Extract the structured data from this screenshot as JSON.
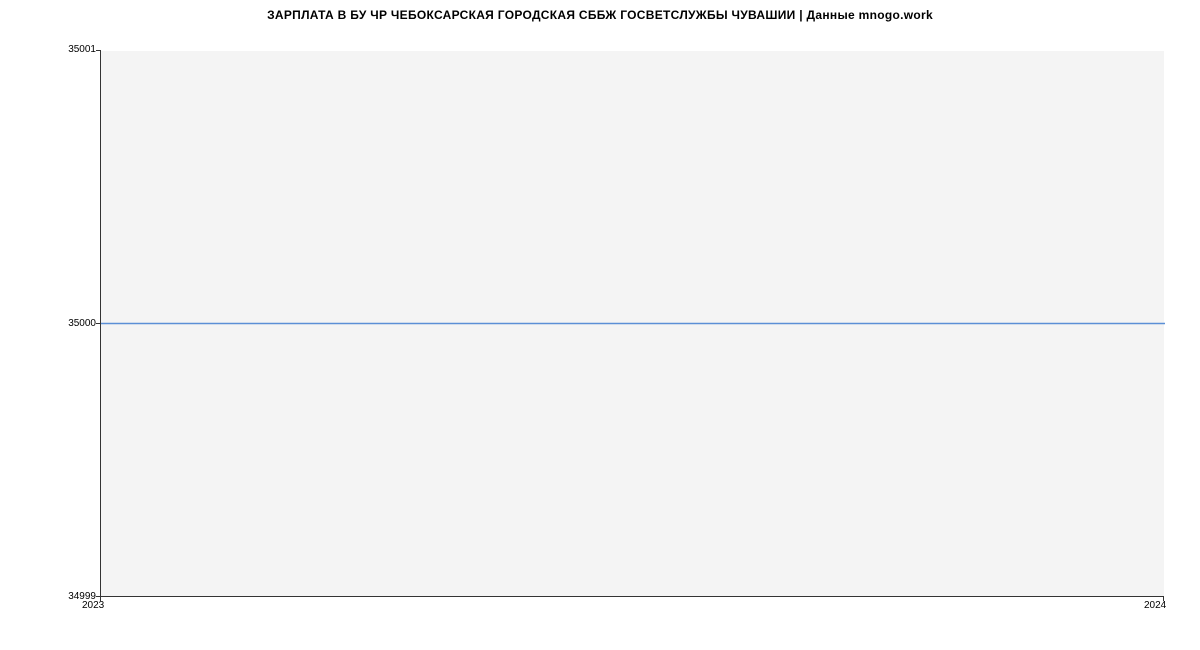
{
  "chart_data": {
    "type": "line",
    "title": "ЗАРПЛАТА В БУ ЧР ЧЕБОКСАРСКАЯ ГОРОДСКАЯ СББЖ ГОСВЕТСЛУЖБЫ ЧУВАШИИ | Данные mnogo.work",
    "x": [
      2023,
      2024
    ],
    "values": [
      35000,
      35000
    ],
    "xlabel": "",
    "ylabel": "",
    "xlim": [
      2023,
      2024
    ],
    "ylim": [
      34999,
      35001
    ],
    "x_ticks": [
      "2023",
      "2024"
    ],
    "y_ticks": [
      "34999",
      "35000",
      "35001"
    ],
    "line_color": "#5b8fd6"
  }
}
